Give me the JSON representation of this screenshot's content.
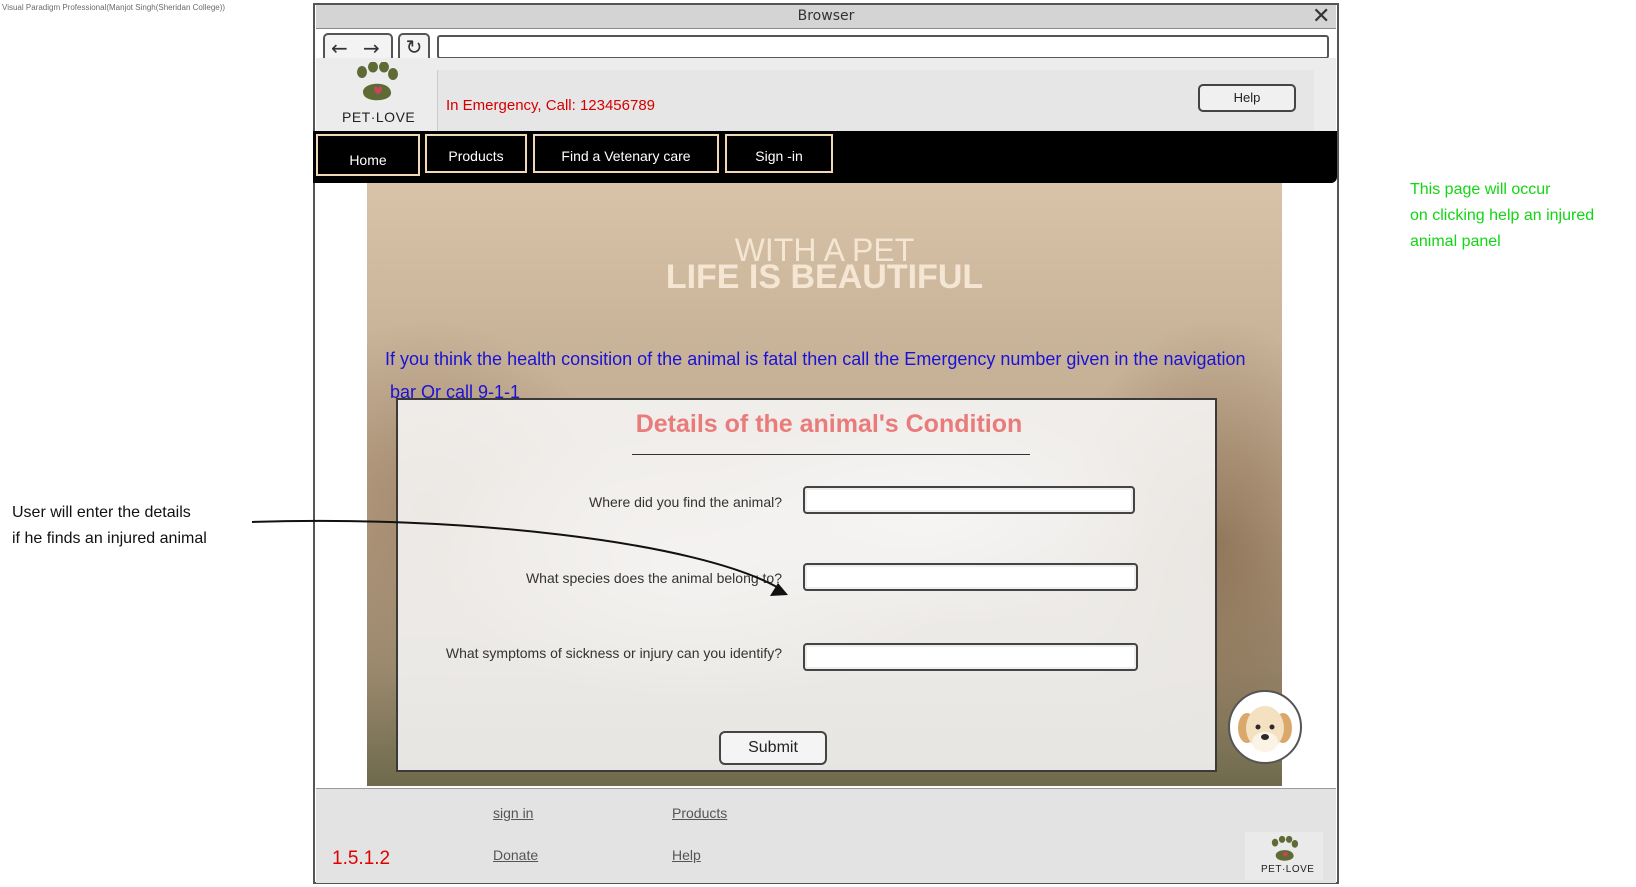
{
  "watermark": "Visual Paradigm Professional(Manjot Singh(Sheridan College))",
  "browser": {
    "title": "Browser",
    "back_glyph": "←",
    "forward_glyph": "→",
    "reload_glyph": "↻",
    "close_glyph": "✕",
    "url": ""
  },
  "header": {
    "brand": "PET·LOVE",
    "emergency": "In Emergency, Call: 123456789",
    "help_label": "Help"
  },
  "nav": {
    "items": [
      {
        "label": "Home"
      },
      {
        "label": "Products"
      },
      {
        "label": "Find a Vetenary care"
      },
      {
        "label": "Sign -in"
      }
    ]
  },
  "hero": {
    "line1": "WITH A PET",
    "line2": "LIFE IS BEAUTIFUL",
    "advice_line1": "If you think the health consition of the animal is fatal then call the Emergency number given in the navigation",
    "advice_line2": "bar Or call 9-1-1"
  },
  "form": {
    "title": "Details of the animal's Condition",
    "questions": [
      {
        "label": "Where did you find the animal?",
        "value": ""
      },
      {
        "label": "What species does the animal belong to?",
        "value": ""
      },
      {
        "label": "What symptoms of sickness or injury can you identify?",
        "value": ""
      }
    ],
    "submit_label": "Submit"
  },
  "footer": {
    "links": [
      {
        "label": "sign in"
      },
      {
        "label": "Products"
      },
      {
        "label": "Donate"
      },
      {
        "label": "Help"
      }
    ],
    "version": "1.5.1.2",
    "brand": "PET·LOVE"
  },
  "annotations": {
    "right_note": [
      "This page will occur",
      "on clicking help an injured",
      "animal panel"
    ],
    "left_note": [
      "User will enter the details",
      "if he finds an injured animal"
    ]
  },
  "colors": {
    "emergency": "#d40000",
    "advice": "#1a12d6",
    "form_title": "#ea7b7b",
    "nav_border": "#f1d9b8",
    "note_green": "#12d612",
    "version": "#e00000",
    "paw": "#5e6b35"
  }
}
